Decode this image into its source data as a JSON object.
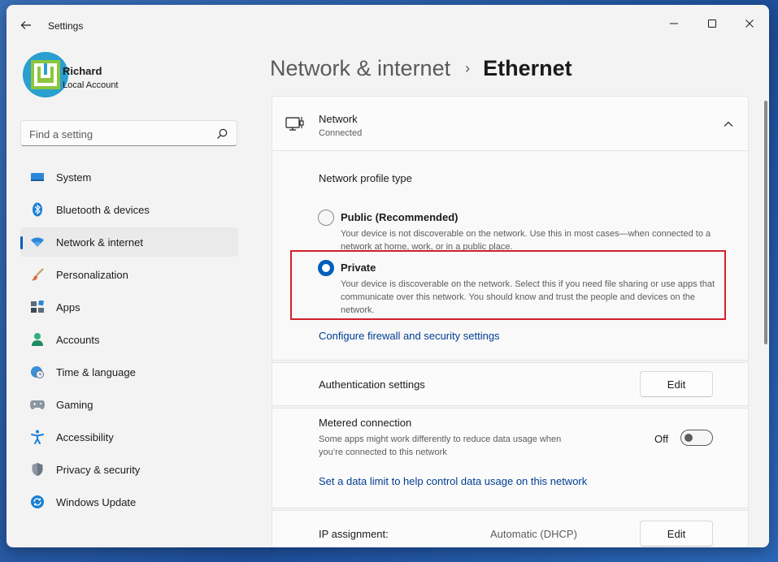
{
  "window": {
    "title": "Settings"
  },
  "user": {
    "name": "Richard",
    "account_type": "Local Account"
  },
  "search": {
    "placeholder": "Find a setting"
  },
  "sidebar": {
    "items": [
      {
        "label": "System",
        "icon": "system-icon"
      },
      {
        "label": "Bluetooth & devices",
        "icon": "bluetooth-icon"
      },
      {
        "label": "Network & internet",
        "icon": "wifi-icon",
        "active": true
      },
      {
        "label": "Personalization",
        "icon": "brush-icon"
      },
      {
        "label": "Apps",
        "icon": "apps-icon"
      },
      {
        "label": "Accounts",
        "icon": "person-icon"
      },
      {
        "label": "Time & language",
        "icon": "globe-clock-icon"
      },
      {
        "label": "Gaming",
        "icon": "gamepad-icon"
      },
      {
        "label": "Accessibility",
        "icon": "accessibility-icon"
      },
      {
        "label": "Privacy & security",
        "icon": "shield-icon"
      },
      {
        "label": "Windows Update",
        "icon": "update-icon"
      }
    ]
  },
  "breadcrumb": {
    "parent": "Network & internet",
    "separator": "›",
    "current": "Ethernet"
  },
  "network": {
    "name": "Network",
    "status": "Connected",
    "profile_type_label": "Network profile type",
    "options": {
      "public": {
        "title": "Public (Recommended)",
        "description": "Your device is not discoverable on the network. Use this in most cases—when connected to a network at home, work, or in a public place.",
        "selected": false
      },
      "private": {
        "title": "Private",
        "description": "Your device is discoverable on the network. Select this if you need file sharing or use apps that communicate over this network. You should know and trust the people and devices on the network.",
        "selected": true
      }
    },
    "firewall_link": "Configure firewall and security settings"
  },
  "authentication": {
    "label": "Authentication settings",
    "button": "Edit"
  },
  "metered": {
    "label": "Metered connection",
    "description": "Some apps might work differently to reduce data usage when you’re connected to this network",
    "state_label": "Off",
    "enabled": false,
    "data_limit_link": "Set a data limit to help control data usage on this network"
  },
  "ip": {
    "label": "IP assignment:",
    "value": "Automatic (DHCP)",
    "button": "Edit"
  },
  "colors": {
    "accent": "#005fb8",
    "highlight_border": "#d1202a",
    "link": "#003e92"
  }
}
